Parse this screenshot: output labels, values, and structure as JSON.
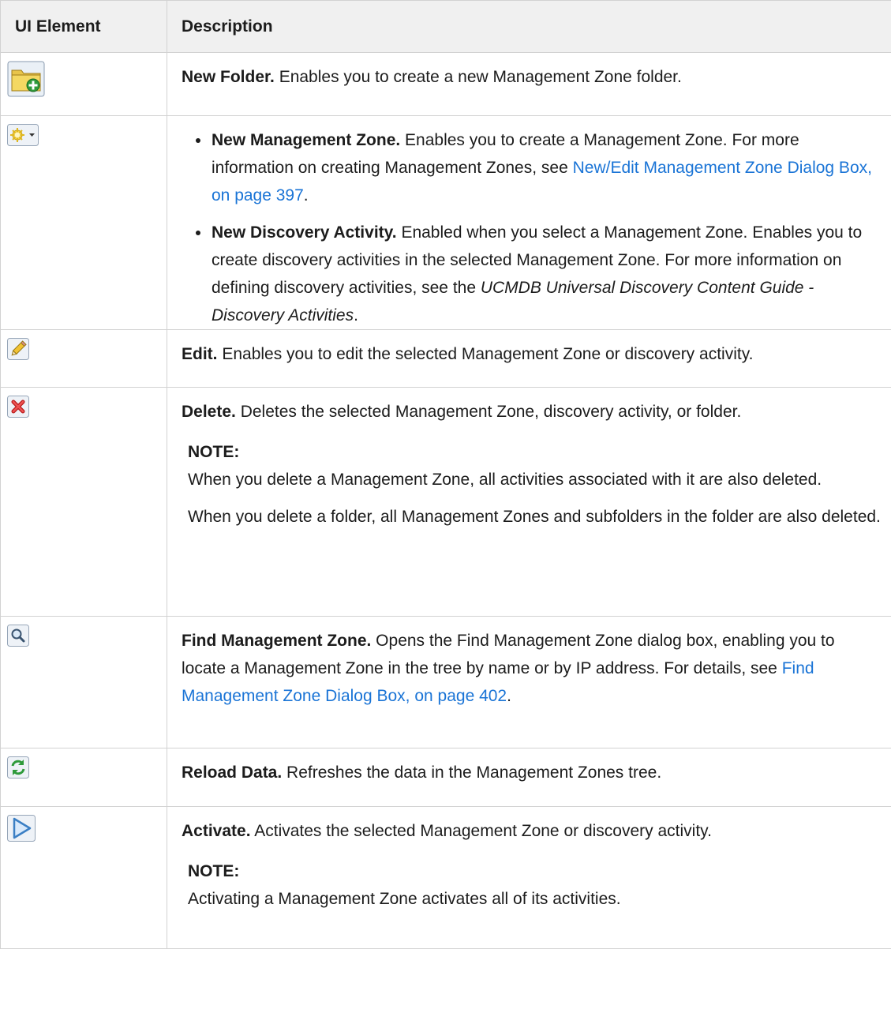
{
  "table": {
    "headers": [
      "UI Element",
      "Description"
    ],
    "rows": [
      {
        "icon": "new-folder-icon",
        "title": "New Folder.",
        "text": " Enables you to create a new Management Zone folder."
      },
      {
        "icon": "new-star-dropdown-icon",
        "bullets": [
          {
            "title": "New Management Zone.",
            "text": " Enables you to create a Management Zone. For more information on creating Management Zones, see ",
            "link": "New/Edit Management Zone Dialog Box, on page 397",
            "after": "."
          },
          {
            "title": "New Discovery Activity.",
            "text": " Enabled when you select a Management Zone. Enables you to create discovery activities in the selected Management Zone. For more information on defining discovery activities, see the ",
            "italic": "UCMDB Universal Discovery Content Guide - Discovery Activities",
            "after": "."
          }
        ]
      },
      {
        "icon": "pencil-edit-icon",
        "title": "Edit.",
        "text": " Enables you to edit the selected Management Zone or discovery activity."
      },
      {
        "icon": "delete-x-icon",
        "title": "Delete.",
        "text": " Deletes the selected Management Zone, discovery activity, or folder.",
        "note_label": "NOTE:",
        "note_lines": [
          "When you delete a Management Zone, all activities associated with it are also deleted.",
          "When you delete a folder, all Management Zones and subfolders in the folder are also deleted."
        ]
      },
      {
        "icon": "magnifier-find-icon",
        "title": "Find Management Zone.",
        "text": " Opens the Find Management Zone dialog box, enabling you to locate a Management Zone in the tree by name or by IP address. For details, see ",
        "link": "Find Management Zone Dialog Box, on page 402",
        "after": "."
      },
      {
        "icon": "reload-refresh-icon",
        "title": "Reload Data.",
        "text": " Refreshes the data in the Management Zones tree."
      },
      {
        "icon": "play-activate-icon",
        "title": "Activate.",
        "text": " Activates the selected Management Zone or discovery activity.",
        "note_label": "NOTE:",
        "note_lines": [
          "Activating a Management Zone activates all of its activities."
        ]
      }
    ]
  },
  "colors": {
    "link": "#1a74d6",
    "header_bg": "#f0f0f0",
    "border": "#d2d2d2"
  }
}
